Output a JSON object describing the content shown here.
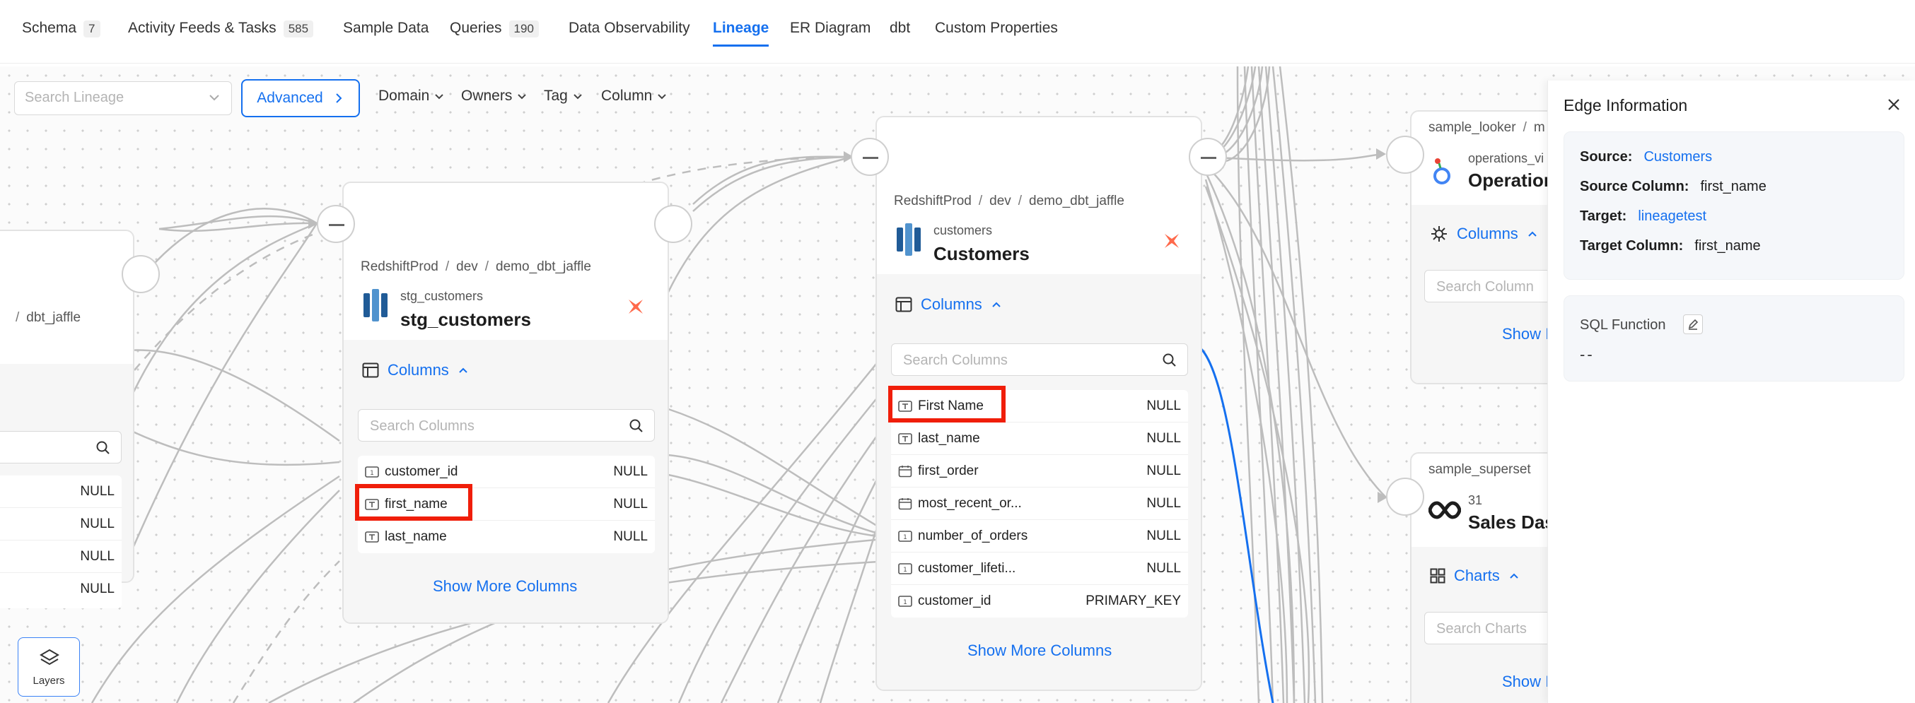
{
  "tabs": [
    {
      "label": "Schema",
      "count": "7"
    },
    {
      "label": "Activity Feeds & Tasks",
      "count": "585"
    },
    {
      "label": "Sample Data"
    },
    {
      "label": "Queries",
      "count": "190"
    },
    {
      "label": "Data Observability"
    },
    {
      "label": "Lineage",
      "active": true
    },
    {
      "label": "ER Diagram"
    },
    {
      "label": "dbt"
    },
    {
      "label": "Custom Properties"
    }
  ],
  "toolbar": {
    "search_placeholder": "Search Lineage",
    "advanced_label": "Advanced",
    "filters": [
      "Domain",
      "Owners",
      "Tag",
      "Column"
    ]
  },
  "nodes": {
    "left": {
      "crumb_last": "dbt_jaffle",
      "rows": [
        {
          "type": "NULL"
        },
        {
          "type": "NULL"
        },
        {
          "type": "NULL"
        },
        {
          "type": "NULL"
        }
      ]
    },
    "stg": {
      "crumbs": [
        "RedshiftProd",
        "dev",
        "demo_dbt_jaffle"
      ],
      "sub": "stg_customers",
      "name": "stg_customers",
      "columns_label": "Columns",
      "search_placeholder": "Search Columns",
      "rows": [
        {
          "name": "customer_id",
          "type": "NULL"
        },
        {
          "name": "first_name",
          "type": "NULL"
        },
        {
          "name": "last_name",
          "type": "NULL"
        }
      ],
      "show_more": "Show More Columns"
    },
    "customers": {
      "crumbs": [
        "RedshiftProd",
        "dev",
        "demo_dbt_jaffle"
      ],
      "sub": "customers",
      "name": "Customers",
      "columns_label": "Columns",
      "search_placeholder": "Search Columns",
      "rows": [
        {
          "name": "First Name",
          "type": "NULL"
        },
        {
          "name": "last_name",
          "type": "NULL"
        },
        {
          "name": "first_order",
          "type": "NULL"
        },
        {
          "name": "most_recent_or...",
          "type": "NULL"
        },
        {
          "name": "number_of_orders",
          "type": "NULL"
        },
        {
          "name": "customer_lifeti...",
          "type": "NULL"
        },
        {
          "name": "customer_id",
          "type": "PRIMARY_KEY"
        }
      ],
      "show_more": "Show More Columns"
    },
    "looker": {
      "crumbs": [
        "sample_looker",
        "m"
      ],
      "sub": "operations_vi",
      "name": "Operation",
      "columns_label": "Columns",
      "search_placeholder": "Search Column",
      "show_more": "Show I"
    },
    "superset": {
      "crumbs": [
        "sample_superset"
      ],
      "sub": "31",
      "name": "Sales Das",
      "charts_label": "Charts",
      "search_placeholder": "Search Charts",
      "show_more": "Show I"
    }
  },
  "layers_label": "Layers",
  "panel": {
    "title": "Edge Information",
    "source_label": "Source:",
    "source_value": "Customers",
    "source_column_label": "Source Column:",
    "source_column_value": "first_name",
    "target_label": "Target:",
    "target_value": "lineagetest",
    "target_column_label": "Target Column:",
    "target_column_value": "first_name",
    "sql_label": "SQL Function",
    "sql_value": "--"
  },
  "colors": {
    "accent": "#1570ef",
    "highlight": "#f01e0a",
    "edge": "#bdbdbd"
  }
}
